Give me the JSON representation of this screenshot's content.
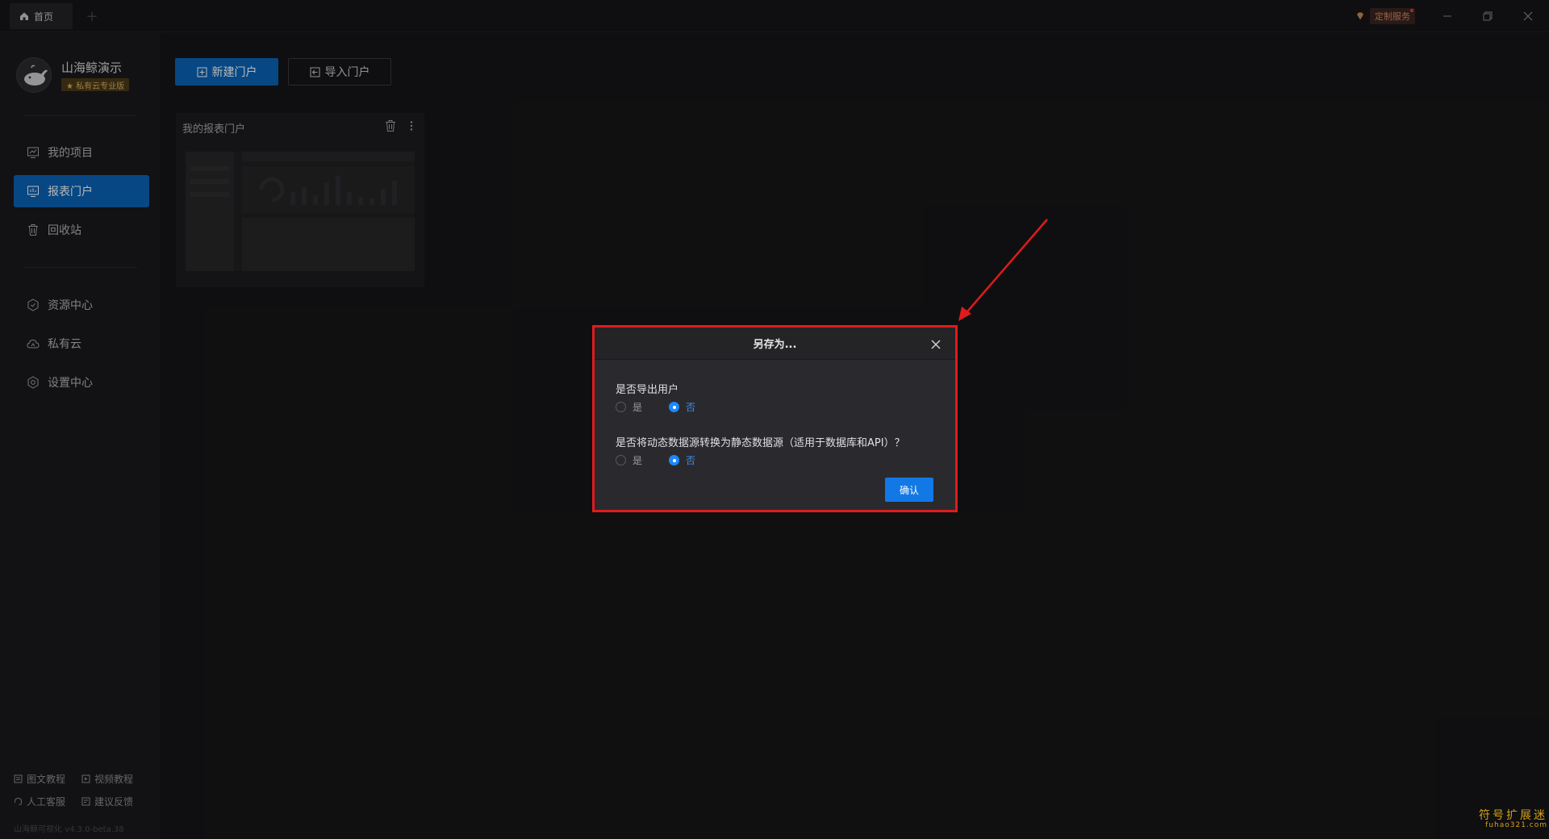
{
  "titlebar": {
    "home_tab": "首页",
    "add_tab": "+",
    "custom_service": "定制服务"
  },
  "sidebar": {
    "brand_name": "山海鲸演示",
    "brand_badge": "★ 私有云专业版",
    "nav": [
      {
        "label": "我的项目",
        "icon": "chart-icon"
      },
      {
        "label": "报表门户",
        "icon": "dashboard-icon",
        "active": true
      },
      {
        "label": "回收站",
        "icon": "trash-icon"
      },
      {
        "label": "资源中心",
        "icon": "hexagon-icon"
      },
      {
        "label": "私有云",
        "icon": "cloud-icon"
      },
      {
        "label": "设置中心",
        "icon": "gear-icon"
      }
    ],
    "footer": {
      "doc_tutorial": "图文教程",
      "video_tutorial": "视频教程",
      "support": "人工客服",
      "feedback": "建议反馈",
      "version": "山海鲸可视化 v4.3.0-beta.38"
    }
  },
  "main": {
    "new_portal": "新建门户",
    "import_portal": "导入门户",
    "card_title": "我的报表门户"
  },
  "modal": {
    "title": "另存为...",
    "q1": "是否导出用户",
    "q2": "是否将动态数据源转换为静态数据源（适用于数据库和API）？",
    "yes": "是",
    "no": "否",
    "q1_selected": "否",
    "q2_selected": "否",
    "confirm": "确认"
  },
  "watermark": {
    "cn": "符号扩展迷",
    "en": "fuhao321.com"
  },
  "colors": {
    "accent": "#0b63b8",
    "highlight": "#e01b1b"
  }
}
